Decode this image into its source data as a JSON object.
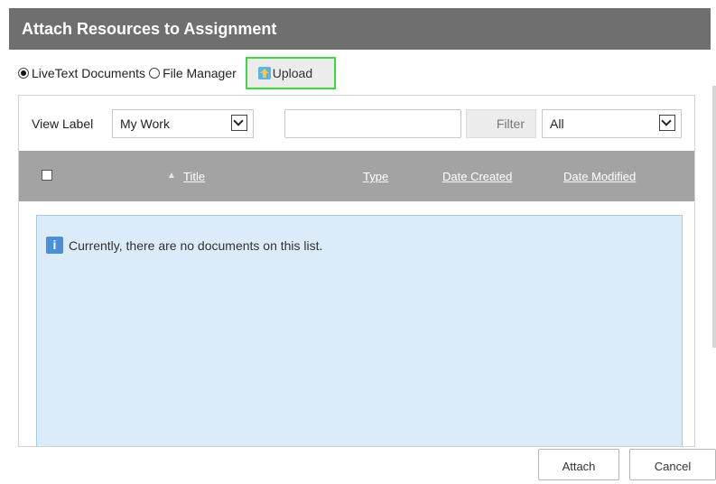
{
  "dialog": {
    "title": "Attach Resources to Assignment"
  },
  "source": {
    "options": [
      {
        "label": "LiveText Documents",
        "selected": true
      },
      {
        "label": "File Manager",
        "selected": false
      }
    ],
    "upload_label": "Upload",
    "upload_icon": "upload-arrow-icon",
    "highlight_color": "#3adb3a"
  },
  "toolbar": {
    "view_label": "View Label",
    "view_select_value": "My Work",
    "search_value": "",
    "filter_label": "Filter",
    "type_select_value": "All"
  },
  "table": {
    "columns": [
      "Title",
      "Type",
      "Date Created",
      "Date Modified"
    ],
    "sort_icon": "sort-up-icon",
    "header_bg": "#a3a3a3"
  },
  "empty_state": {
    "icon": "info-icon",
    "message": "Currently, there are no documents on this list.",
    "bg_color": "#dcebf9"
  },
  "footer": {
    "attach_label": "Attach",
    "cancel_label": "Cancel"
  }
}
